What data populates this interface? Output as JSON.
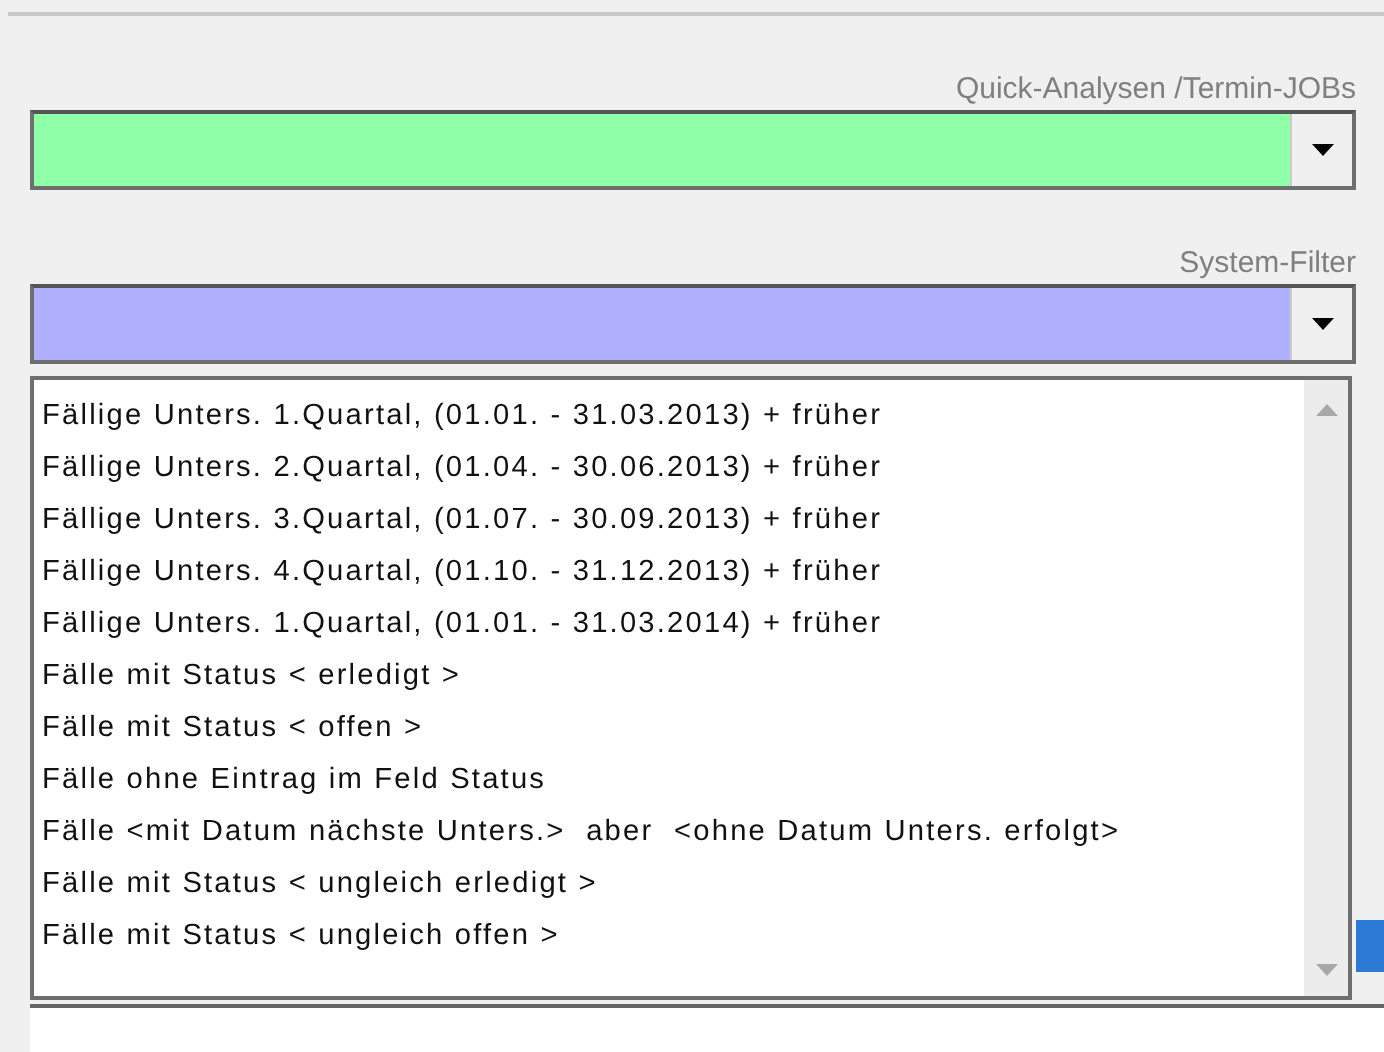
{
  "quick_analysen": {
    "label": "Quick-Analysen /Termin-JOBs",
    "color": "#8fffa8"
  },
  "system_filter": {
    "label": "System-Filter",
    "color": "#b0b0ff",
    "expanded": true,
    "options": [
      "Fällige Unters. 1.Quartal, (01.01. - 31.03.2013) + früher",
      "Fällige Unters. 2.Quartal, (01.04. - 30.06.2013) + früher",
      "Fällige Unters. 3.Quartal, (01.07. - 30.09.2013) + früher",
      "Fällige Unters. 4.Quartal, (01.10. - 31.12.2013) + früher",
      "Fällige Unters. 1.Quartal, (01.01. - 31.03.2014) + früher",
      "Fälle mit Status < erledigt >",
      "Fälle mit Status < offen >",
      "Fälle ohne Eintrag im Feld Status",
      "Fälle <mit Datum nächste Unters.>  aber  <ohne Datum Unters. erfolgt>",
      "Fälle mit Status < ungleich erledigt >",
      "Fälle mit Status < ungleich offen >"
    ]
  }
}
